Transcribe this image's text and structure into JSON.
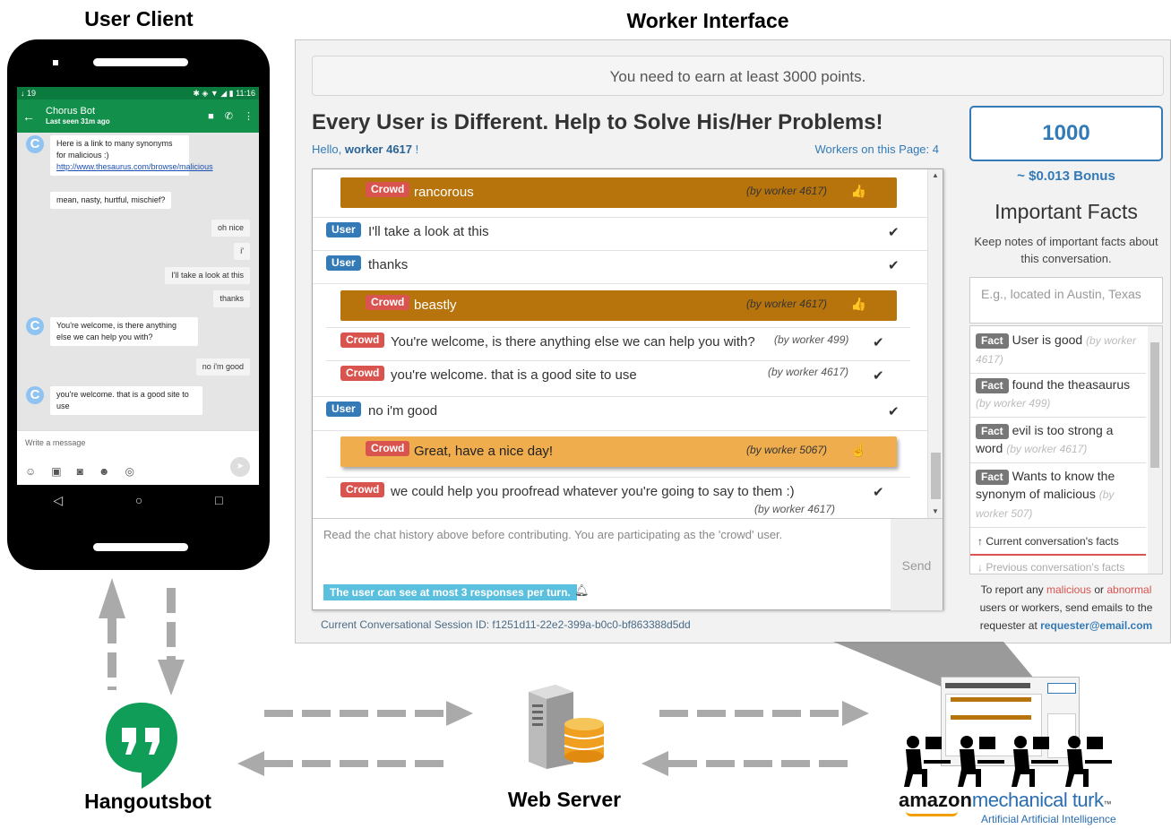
{
  "headings": {
    "user_client": "User Client",
    "worker_interface": "Worker Interface"
  },
  "phone": {
    "status_left": "↓ 19",
    "status_right": "✱ ◈ ▼ ◢ ▮ 11:16",
    "contact_name": "Chorus Bot",
    "last_seen": "Last seen 31m ago",
    "messages": [
      {
        "text": "Here is a link to many synonyms for malicious :) ",
        "link": "http://www.thesaurus.com/browse/malicious",
        "side": "bot"
      },
      {
        "text": "mean, nasty, hurtful, mischief?",
        "side": "bot"
      },
      {
        "text": "oh nice",
        "side": "user"
      },
      {
        "text": "i'",
        "side": "user"
      },
      {
        "text": "I'll take a look at this",
        "side": "user"
      },
      {
        "text": "thanks",
        "side": "user"
      },
      {
        "text": "You're welcome, is there anything else we can help you with?",
        "side": "bot"
      },
      {
        "text": "no i'm good",
        "side": "user"
      },
      {
        "text": "you're welcome.  that is a good site to use",
        "side": "bot"
      }
    ],
    "write_placeholder": "Write a message"
  },
  "worker": {
    "notice": "You need to earn at least 3000 points.",
    "title": "Every User is Different. Help to Solve His/Her Problems!",
    "hello_prefix": "Hello, ",
    "hello_name": "worker 4617",
    "hello_suffix": " !",
    "workers_on_page": "Workers on this Page: 4",
    "chat_rows": [
      {
        "label": "Crowd",
        "text": "rancorous",
        "by": "(by worker 4617)",
        "style": "dark-orange"
      },
      {
        "label": "User",
        "text": "I'll take a look at this"
      },
      {
        "label": "User",
        "text": "thanks"
      },
      {
        "label": "Crowd",
        "text": "beastly",
        "by": "(by worker 4617)",
        "style": "dark-orange"
      },
      {
        "label": "Crowd",
        "text": "You're welcome, is there anything else we can help you with?",
        "by": "(by worker 499)"
      },
      {
        "label": "Crowd",
        "text": "you're welcome. that is a good site to use",
        "by": "(by worker 4617)"
      },
      {
        "label": "User",
        "text": "no i'm good"
      },
      {
        "label": "Crowd",
        "text": "Great, have a nice day!",
        "by": "(by worker 5067)",
        "style": "light-orange"
      },
      {
        "label": "Crowd",
        "text": "we could help you proofread whatever you're going to say to them :)",
        "by": "(by worker 4617)"
      }
    ],
    "composer_hint": "Read the chat history above before contributing. You are participating as the 'crowd' user.",
    "send_label": "Send",
    "response_cap": "The user can see at most 3 responses per turn.",
    "session_id": "Current Conversational Session ID: f1251d11-22e2-399a-b0c0-bf863388d5dd",
    "points": "1000",
    "bonus": "~ $0.013 Bonus",
    "facts_title": "Important Facts",
    "facts_desc": "Keep notes of important facts about this conversation.",
    "fact_placeholder": "E.g., located in Austin, Texas",
    "facts": [
      {
        "label": "Fact",
        "text": "User is good",
        "by": "(by worker 4617)"
      },
      {
        "label": "Fact",
        "text": "found the theasaurus",
        "by": "(by worker 499)"
      },
      {
        "label": "Fact",
        "text": "evil is too strong a word",
        "by": "(by worker 4617)"
      },
      {
        "label": "Fact",
        "text": "Wants to know the synonym of malicious",
        "by": "(by worker 507)"
      }
    ],
    "current_facts": "Current conversation's facts",
    "previous_facts": "Previous conversation's facts",
    "report": {
      "p1": "To report any ",
      "malicious": "malicious",
      "or": " or ",
      "abnormal": "abnormal",
      "p2": " users or workers, send emails to the requester at ",
      "email": "requester@email.com"
    }
  },
  "diagram": {
    "hangouts": "Hangoutsbot",
    "server": "Web Server",
    "mturk_amazon": "amazon",
    "mturk_brand": "mechanical turk",
    "mturk_tagline": "Artificial Artificial Intelligence",
    "colors": {
      "arrow": "#aaaaaa",
      "hangouts_green": "#0f9d58",
      "db_orange": "#f0a020"
    }
  }
}
